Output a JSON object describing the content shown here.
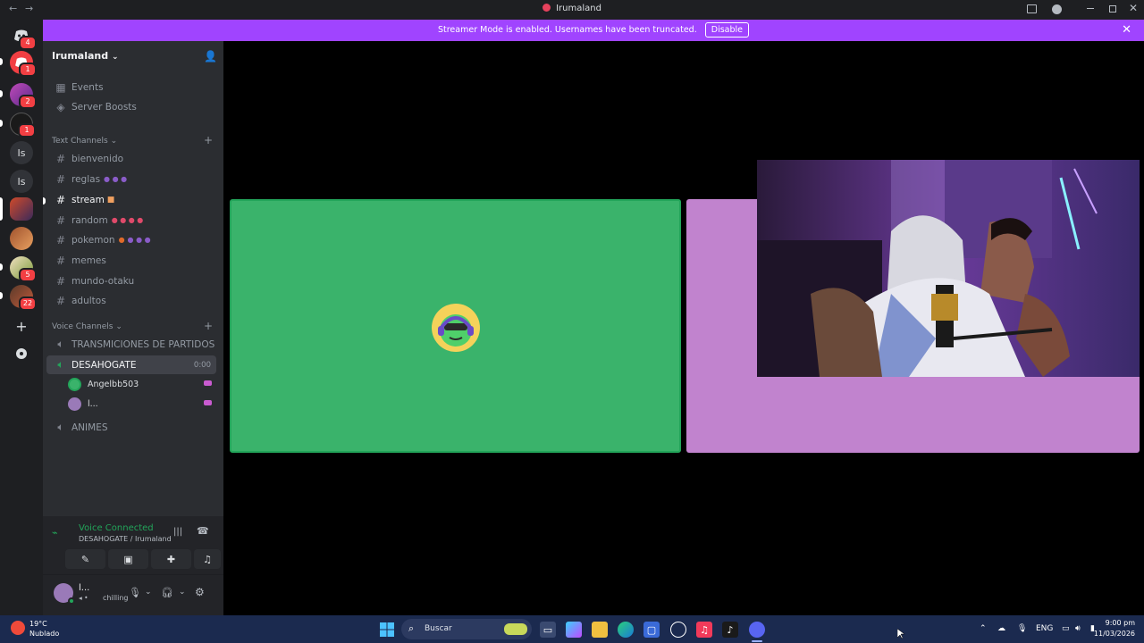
{
  "window": {
    "title": "Irumaland",
    "nav_back": "←",
    "nav_forward": "→"
  },
  "banner": {
    "text": "Streamer Mode is enabled. Usernames have been truncated.",
    "disable_label": "Disable"
  },
  "server_rail": {
    "badges": [
      "4",
      "1",
      "2",
      "1",
      "5",
      "22"
    ],
    "text_servers": [
      "Is",
      "Is"
    ]
  },
  "sidebar": {
    "guild_name": "Irumaland",
    "top_items": [
      {
        "label": "Events",
        "icon": "calendar-icon"
      },
      {
        "label": "Server Boosts",
        "icon": "boost-icon"
      }
    ],
    "text_category": "Text Channels",
    "text_channels": [
      {
        "label": "bienvenido"
      },
      {
        "label": "reglas"
      },
      {
        "label": "stream"
      },
      {
        "label": "random"
      },
      {
        "label": "pokemon"
      },
      {
        "label": "memes"
      },
      {
        "label": "mundo-otaku"
      },
      {
        "label": "adultos"
      }
    ],
    "voice_category": "Voice Channels",
    "voice_channels": [
      {
        "label": "TRANSMICIONES DE PARTIDOS"
      },
      {
        "label": "DESAHOGATE",
        "timer": "0:00"
      },
      {
        "label": "ANIMES"
      }
    ],
    "voice_users": [
      {
        "name": "Angelbb503"
      },
      {
        "name": "l..."
      }
    ]
  },
  "voice_panel": {
    "status": "Voice Connected",
    "location": "DESAHOGATE / Irumaland"
  },
  "user_panel": {
    "name": "l...",
    "status": "chilling"
  },
  "taskbar": {
    "weather_temp": "19°C",
    "weather_desc": "Nublado",
    "search_placeholder": "Buscar",
    "language": "ENG",
    "time": "9:00 pm",
    "date": "11/03/2026"
  },
  "colors": {
    "banner": "#a044ff",
    "tile_green": "#3ab36b",
    "tile_pink": "#c183ce",
    "voice_green": "#23a55a"
  }
}
